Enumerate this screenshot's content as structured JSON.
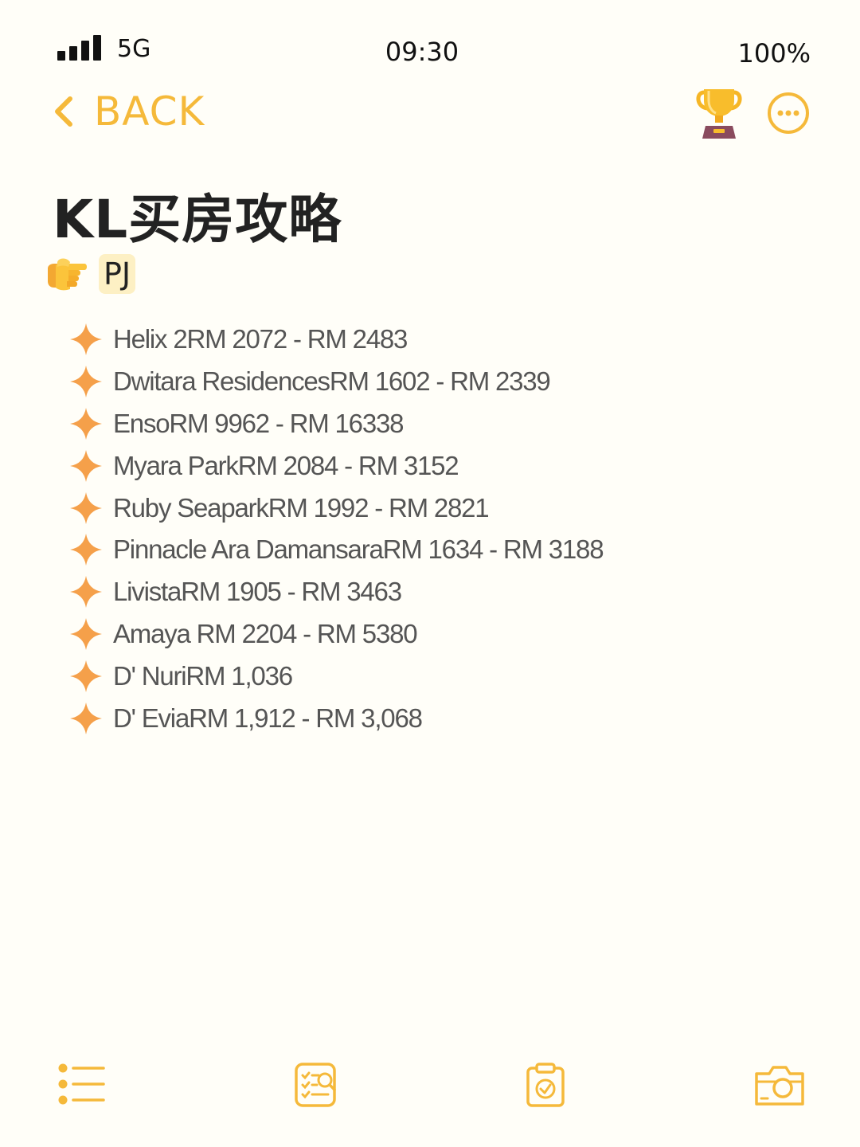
{
  "status_bar": {
    "network": "5G",
    "time": "09:30",
    "battery": "100%"
  },
  "nav": {
    "back_label": "BACK"
  },
  "page": {
    "title": "KL买房攻略",
    "section_tag": "PJ"
  },
  "listings": [
    "Helix 2RM 2072 - RM 2483",
    "Dwitara ResidencesRM 1602 - RM 2339",
    "EnsoRM 9962 - RM 16338",
    "Myara ParkRM 2084 - RM 3152",
    "Ruby SeaparkRM 1992 - RM 2821",
    "Pinnacle Ara DamansaraRM 1634 - RM 3188",
    "LivistaRM 1905 - RM 3463",
    "Amaya RM 2204 - RM 5380",
    "D' NuriRM 1,036",
    "D' EviaRM 1,912 - RM 3,068"
  ],
  "toolbar": {
    "items": [
      "list-icon",
      "checklist-search-icon",
      "clipboard-check-icon",
      "camera-icon"
    ]
  },
  "colors": {
    "accent": "#f5b93a",
    "sparkle": "#f5a04a",
    "background": "#fffef8",
    "list_text": "#555555",
    "tag_highlight": "#fdf0c4"
  }
}
